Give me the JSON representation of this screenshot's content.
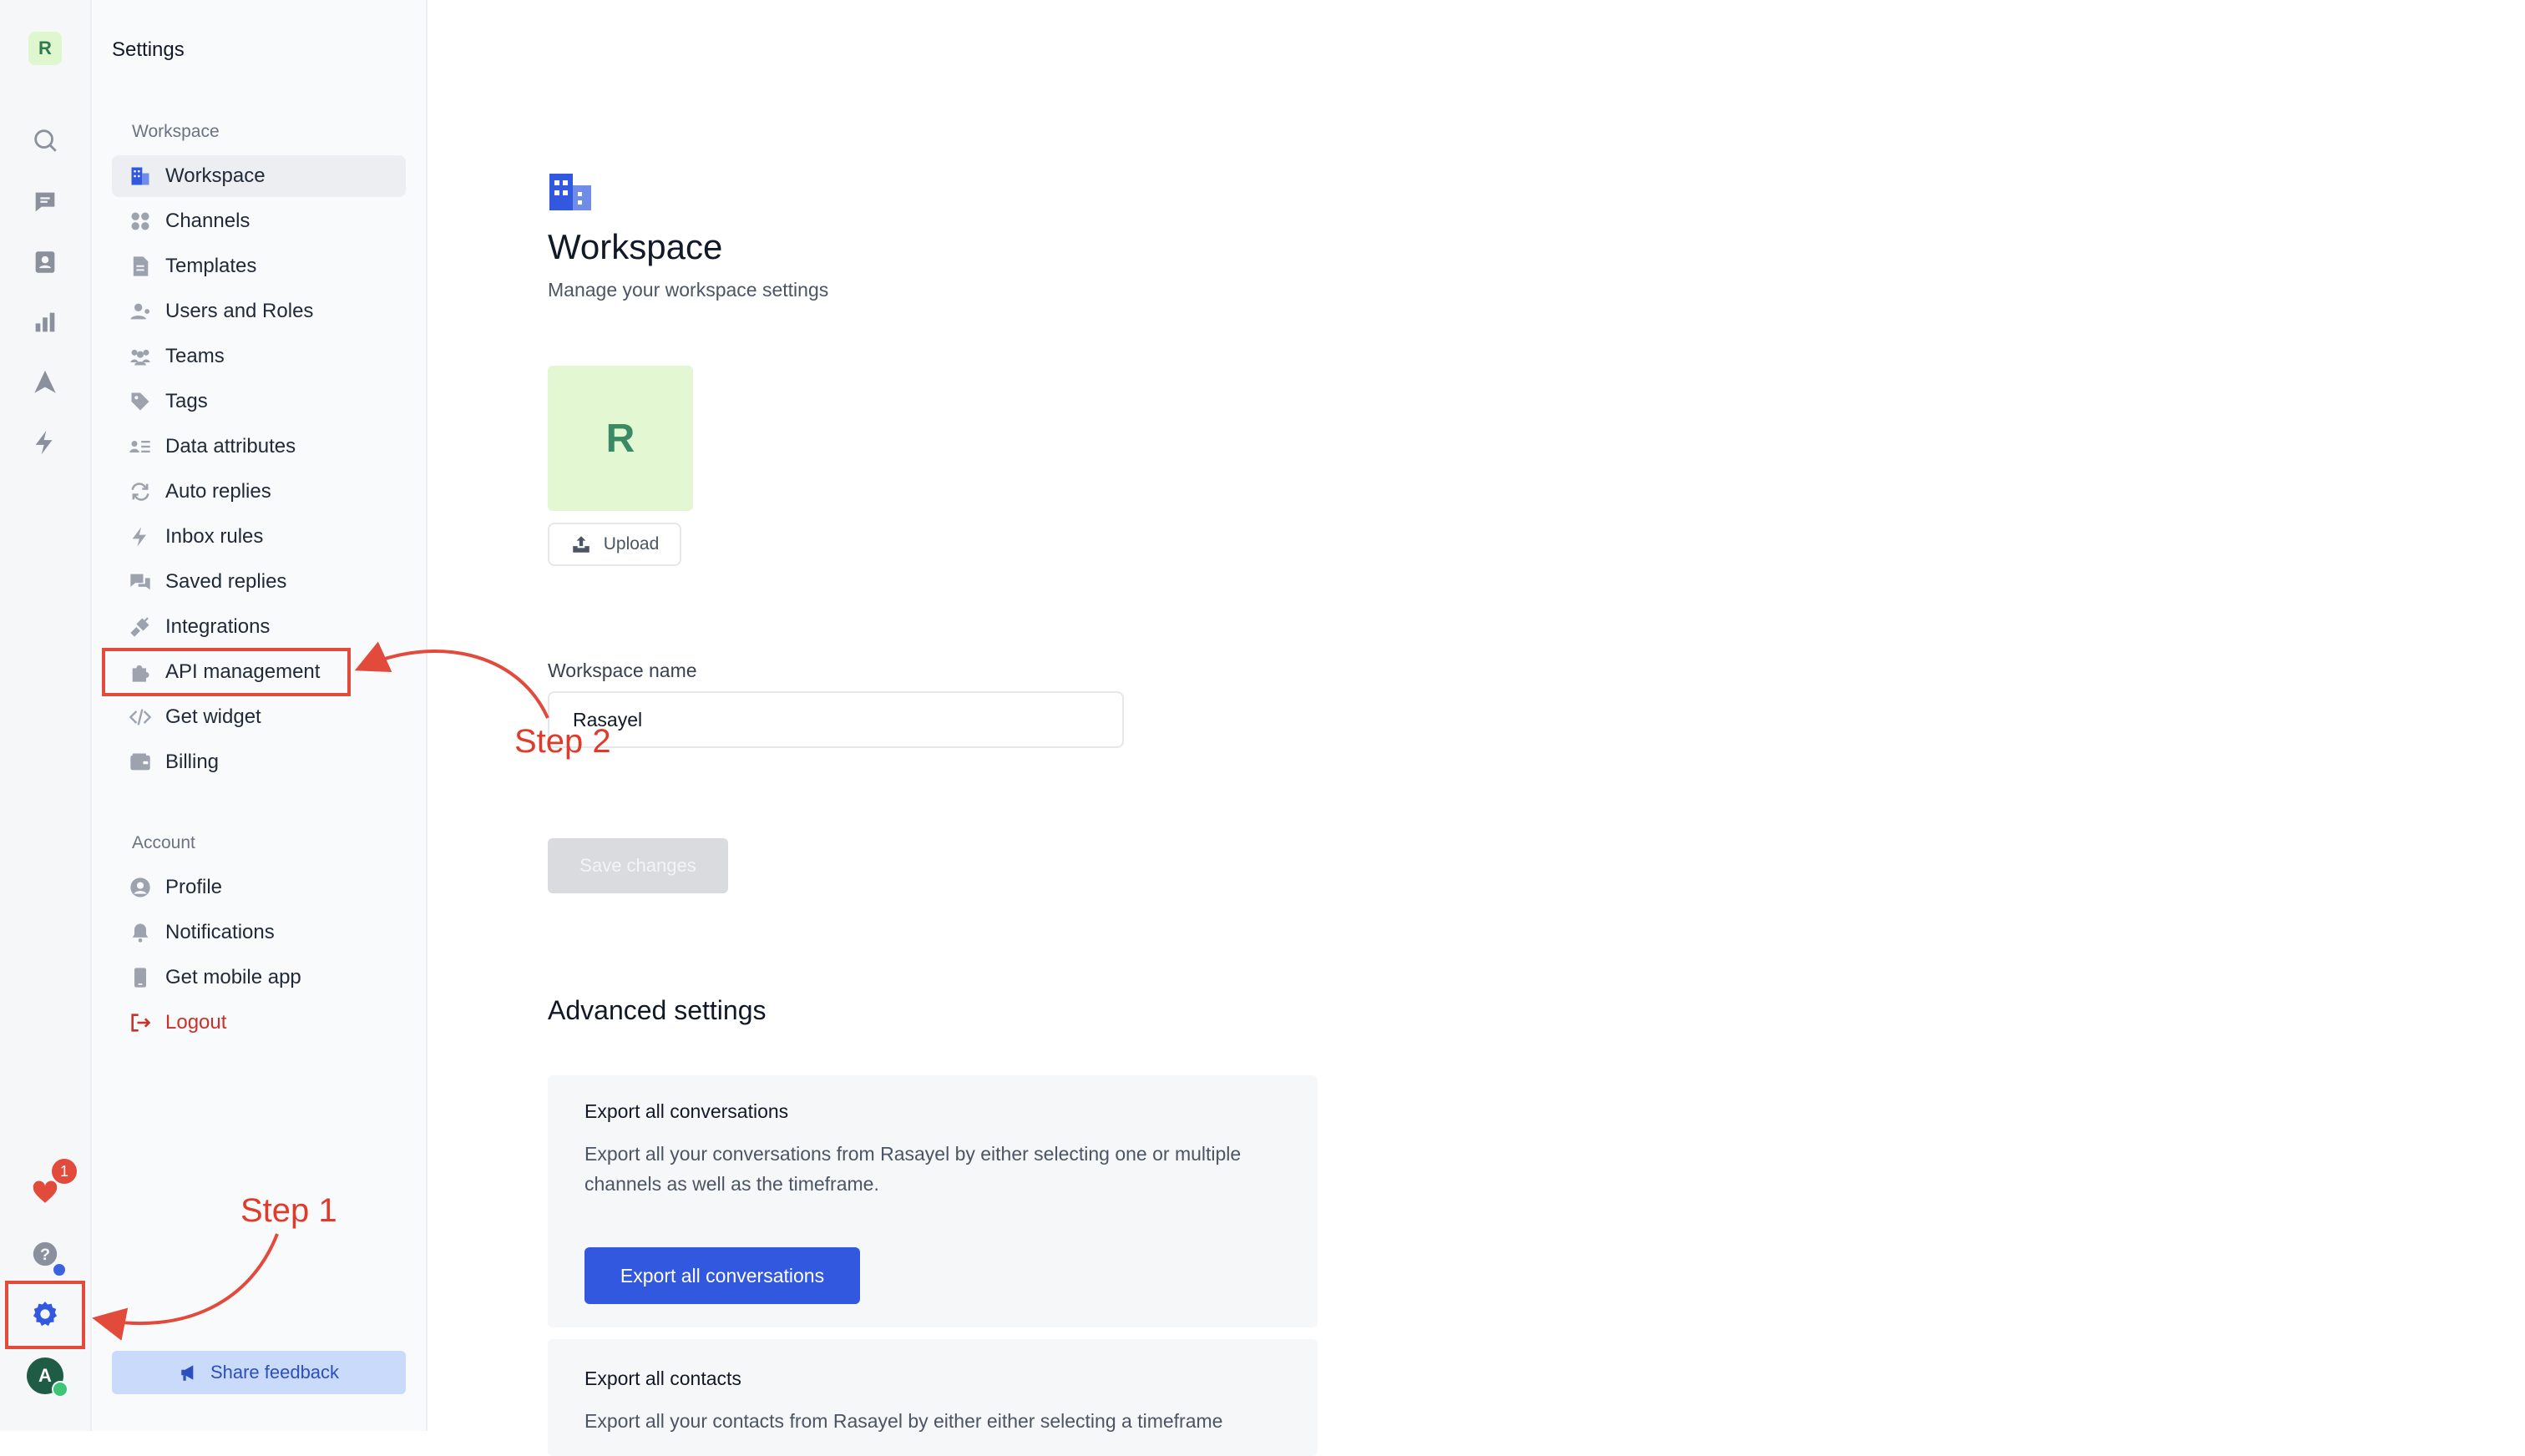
{
  "rail": {
    "workspace_initial": "R",
    "notification_count": "1",
    "user_initial": "A",
    "icons": [
      "search-icon",
      "conversations-icon",
      "contacts-icon",
      "reports-icon",
      "campaigns-icon",
      "automation-icon",
      "heart-icon",
      "help-icon",
      "settings-icon"
    ]
  },
  "sidebar": {
    "title": "Settings",
    "workspace_section": "Workspace",
    "workspace_items": [
      {
        "label": "Workspace",
        "icon": "building-icon",
        "active": true
      },
      {
        "label": "Channels",
        "icon": "channels-icon"
      },
      {
        "label": "Templates",
        "icon": "template-icon"
      },
      {
        "label": "Users and Roles",
        "icon": "users-icon"
      },
      {
        "label": "Teams",
        "icon": "teams-icon"
      },
      {
        "label": "Tags",
        "icon": "tag-icon"
      },
      {
        "label": "Data attributes",
        "icon": "data-attributes-icon"
      },
      {
        "label": "Auto replies",
        "icon": "auto-reply-icon"
      },
      {
        "label": "Inbox rules",
        "icon": "bolt-icon"
      },
      {
        "label": "Saved replies",
        "icon": "saved-replies-icon"
      },
      {
        "label": "Integrations",
        "icon": "plug-icon"
      },
      {
        "label": "API management",
        "icon": "puzzle-icon"
      },
      {
        "label": "Get widget",
        "icon": "code-icon"
      },
      {
        "label": "Billing",
        "icon": "wallet-icon"
      }
    ],
    "account_section": "Account",
    "account_items": [
      {
        "label": "Profile",
        "icon": "profile-icon"
      },
      {
        "label": "Notifications",
        "icon": "bell-icon"
      },
      {
        "label": "Get mobile app",
        "icon": "mobile-icon"
      },
      {
        "label": "Logout",
        "icon": "logout-icon"
      }
    ],
    "feedback_label": "Share feedback"
  },
  "main": {
    "title": "Workspace",
    "subtitle": "Manage your workspace settings",
    "logo_initial": "R",
    "upload_label": "Upload",
    "name_label": "Workspace name",
    "name_value": "Rasayel",
    "save_label": "Save changes",
    "advanced_title": "Advanced settings",
    "export_conversations": {
      "title": "Export all conversations",
      "description": "Export all your conversations from Rasayel by either selecting one or multiple channels as well as the timeframe.",
      "button": "Export all conversations"
    },
    "export_contacts": {
      "title": "Export all contacts",
      "description": "Export all your contacts from Rasayel by either either selecting a timeframe"
    }
  },
  "annotations": {
    "step1": "Step 1",
    "step2": "Step 2",
    "color": "#e24b3b"
  }
}
